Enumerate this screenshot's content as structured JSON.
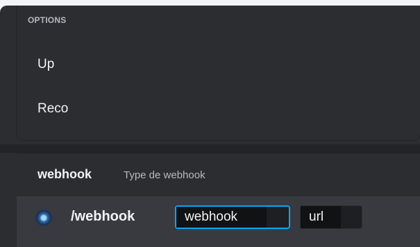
{
  "options": {
    "header": "OPTIONS",
    "items": [
      {
        "label": "Up"
      },
      {
        "label": "Reco"
      }
    ]
  },
  "command_info": {
    "name": "webhook",
    "description": "Type de webhook"
  },
  "input": {
    "command": "/webhook",
    "params": [
      {
        "label": "webhook",
        "active": true
      },
      {
        "label": "url",
        "active": false
      }
    ]
  },
  "colors": {
    "background": "#2b2d31",
    "input_bar": "#383a40",
    "focus_border": "#00a8fc",
    "text_primary": "#f2f3f5",
    "text_muted": "#b5bac1"
  },
  "icons": {
    "bot_avatar": "bot-avatar-icon"
  }
}
